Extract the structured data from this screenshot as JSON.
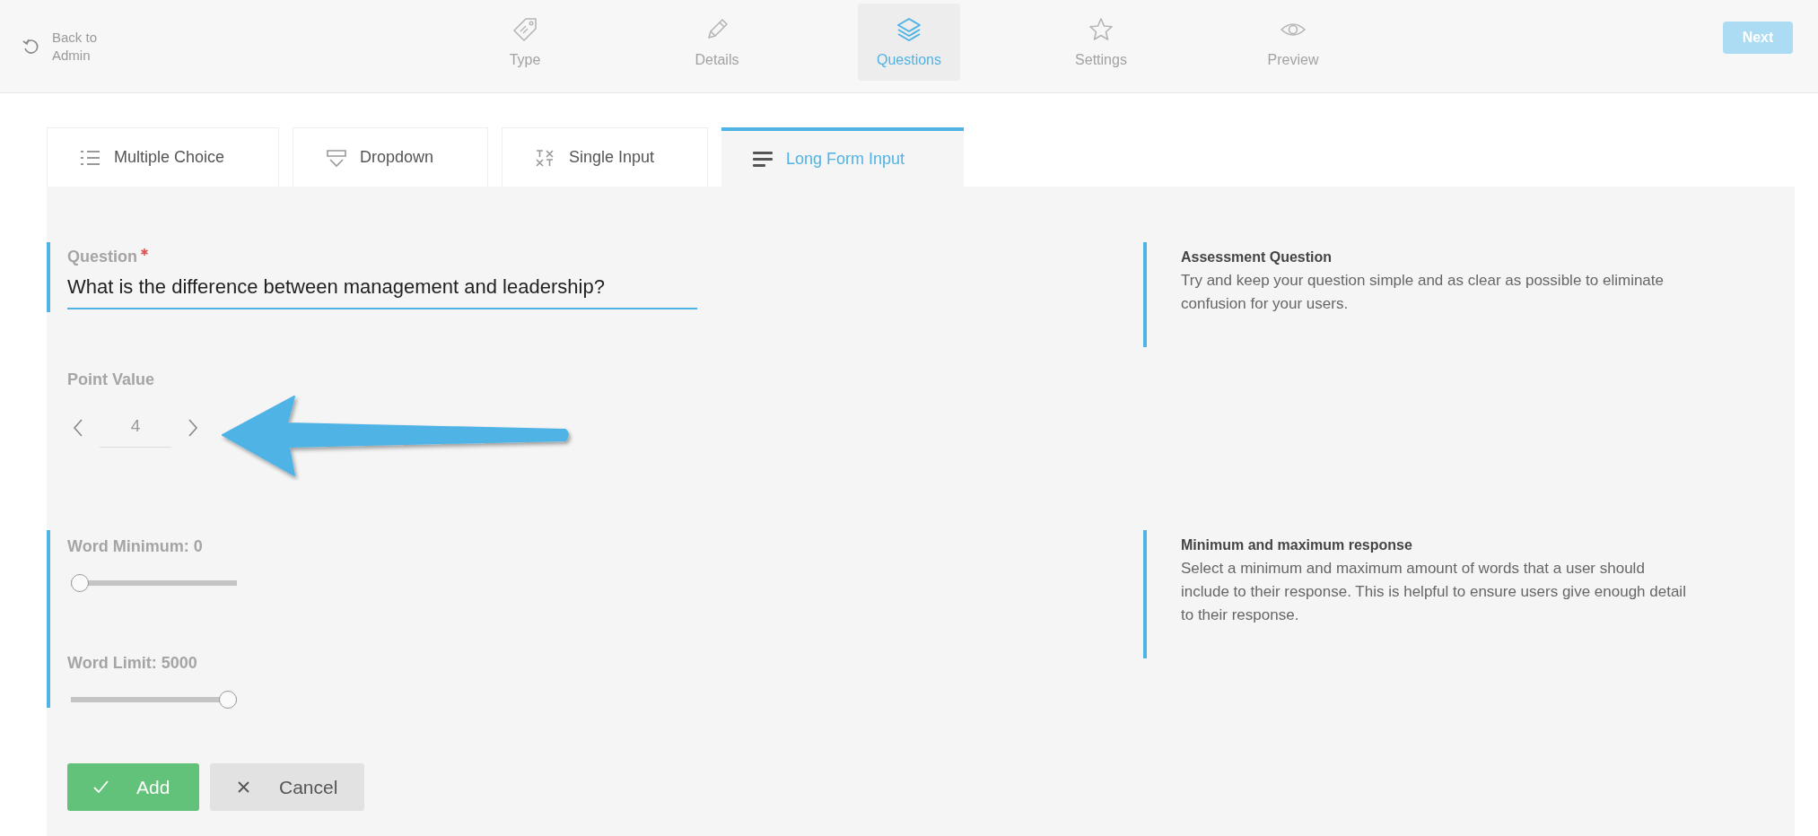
{
  "back_link": {
    "label": "Back to\nAdmin"
  },
  "steps": [
    {
      "label": "Type",
      "selected": false
    },
    {
      "label": "Details",
      "selected": false
    },
    {
      "label": "Questions",
      "selected": true
    },
    {
      "label": "Settings",
      "selected": false
    },
    {
      "label": "Preview",
      "selected": false
    }
  ],
  "next_button": {
    "label": "Next",
    "disabled": true
  },
  "question_types": [
    {
      "label": "Multiple Choice",
      "selected": false
    },
    {
      "label": "Dropdown",
      "selected": false
    },
    {
      "label": "Single Input",
      "selected": false
    },
    {
      "label": "Long Form Input",
      "selected": true
    }
  ],
  "question": {
    "label": "Question",
    "required": true,
    "value": "What is the difference between management and leadership?"
  },
  "point_value": {
    "label": "Point Value",
    "value": "4"
  },
  "sliders": [
    {
      "label": "Word Minimum: 0",
      "level": 0
    },
    {
      "label": "Word Limit: 5000",
      "level": 1
    }
  ],
  "hints": [
    {
      "title": "Assessment Question",
      "text": "Try and keep your question simple and as clear as possible to eliminate confusion for your users."
    },
    {
      "title": "Minimum and maximum response",
      "text": "Select a minimum and maximum amount of words that a user should include to their response. This is helpful to ensure users give enough detail to their response."
    }
  ],
  "buttons": [
    {
      "label": "Add",
      "kind": "confirm"
    },
    {
      "label": "Cancel",
      "kind": "cancel"
    }
  ]
}
